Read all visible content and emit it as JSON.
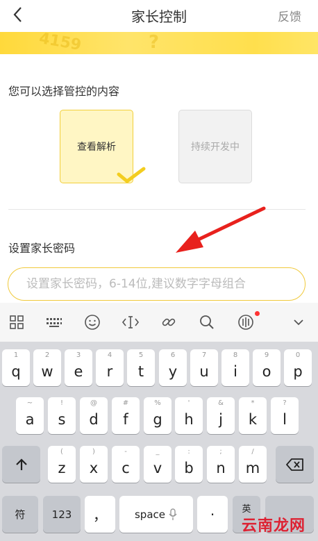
{
  "header": {
    "title": "家长控制",
    "feedback": "反馈"
  },
  "banner": {
    "deco_text": "4159",
    "deco_mark": "?"
  },
  "content": {
    "section1_label": "您可以选择管控的内容",
    "options": [
      {
        "label": "查看解析",
        "selected": true
      },
      {
        "label": "持续开发中",
        "selected": false
      }
    ],
    "section2_label": "设置家长密码",
    "password_placeholder": "设置家长密码，6-14位,建议数字字母组合"
  },
  "keyboard": {
    "row1": [
      {
        "hint": "1",
        "key": "q"
      },
      {
        "hint": "2",
        "key": "w"
      },
      {
        "hint": "3",
        "key": "e"
      },
      {
        "hint": "4",
        "key": "r"
      },
      {
        "hint": "5",
        "key": "t"
      },
      {
        "hint": "6",
        "key": "y"
      },
      {
        "hint": "7",
        "key": "u"
      },
      {
        "hint": "8",
        "key": "i"
      },
      {
        "hint": "9",
        "key": "o"
      },
      {
        "hint": "0",
        "key": "p"
      }
    ],
    "row2": [
      {
        "hint": "~",
        "key": "a"
      },
      {
        "hint": "!",
        "key": "s"
      },
      {
        "hint": "@",
        "key": "d"
      },
      {
        "hint": "#",
        "key": "f"
      },
      {
        "hint": "%",
        "key": "g"
      },
      {
        "hint": "'",
        "key": "h"
      },
      {
        "hint": "&",
        "key": "j"
      },
      {
        "hint": "*",
        "key": "k"
      },
      {
        "hint": "?",
        "key": "l"
      }
    ],
    "row3": [
      {
        "hint": "(",
        "key": "z"
      },
      {
        "hint": ")",
        "key": "x"
      },
      {
        "hint": "-",
        "key": "c"
      },
      {
        "hint": "_",
        "key": "v"
      },
      {
        "hint": ":",
        "key": "b"
      },
      {
        "hint": ";",
        "key": "n"
      },
      {
        "hint": "/",
        "key": "m"
      }
    ],
    "symbols_label": "符",
    "numbers_label": "123",
    "comma_label": "，",
    "space_label": "space",
    "period_label": "·",
    "lang_label": "英"
  },
  "watermark": "云南龙网"
}
